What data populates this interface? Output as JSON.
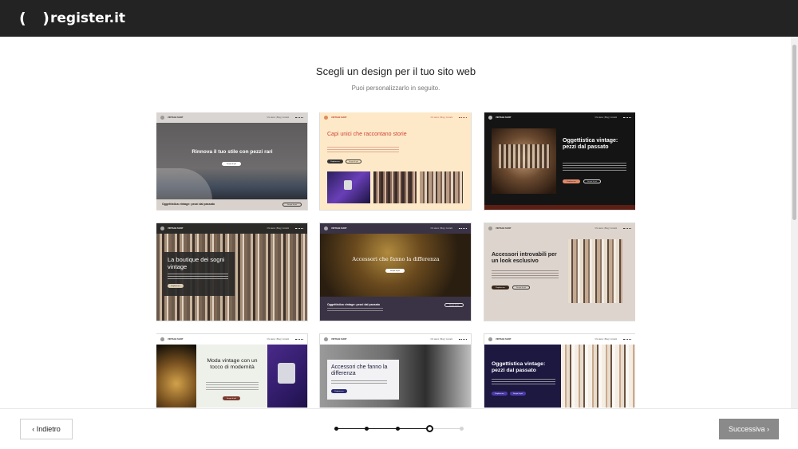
{
  "header": {
    "logo_mark": "( )",
    "logo_text": "register.it"
  },
  "page": {
    "title": "Scegli un design per il tuo sito web",
    "subtitle": "Puoi personalizzarlo in seguito."
  },
  "templates": {
    "t1": {
      "brand": "VINTAGE SHOP",
      "menu": "Chi siamo | Blog | Contatti",
      "headline": "Rinnova il tuo stile con pezzi rari",
      "cta": "Scopri di più",
      "footer_title": "Oggettistica vintage: pezzi dal passato",
      "footer_cta": "Scopri di più"
    },
    "t2": {
      "brand": "VINTAGE SHOP",
      "menu": "Chi siamo | Blog | Contatti",
      "headline": "Capi unici che raccontano storie",
      "cta1": "Esplora ora",
      "cta2": "Scopri di più"
    },
    "t3": {
      "brand": "VINTAGE SHOP",
      "menu": "Chi siamo | Blog | Contatti",
      "headline": "Oggettistica vintage: pezzi dal passato",
      "cta1": "Esplora ora",
      "cta2": "Scopri di più"
    },
    "t4": {
      "brand": "VINTAGE SHOP",
      "menu": "Chi siamo | Blog | Contatti",
      "headline": "La boutique dei sogni vintage",
      "cta": "Esplora ora"
    },
    "t5": {
      "brand": "VINTAGE SHOP",
      "menu": "Chi siamo | Blog | Contatti",
      "headline": "Accessori che fanno la differenza",
      "cta": "Scopri di più",
      "footer_title": "Oggettistica vintage: pezzi dal passato",
      "footer_cta": "Scopri di più"
    },
    "t6": {
      "brand": "VINTAGE SHOP",
      "menu": "Chi siamo | Blog | Contatti",
      "headline": "Accessori introvabili per un look esclusivo",
      "cta1": "Esplora ora",
      "cta2": "Scopri di più"
    },
    "t7": {
      "brand": "VINTAGE SHOP",
      "menu": "Chi siamo | Blog | Contatti",
      "headline": "Moda vintage con un tocco di modernità",
      "cta": "Scopri di più"
    },
    "t8": {
      "brand": "VINTAGE SHOP",
      "menu": "Chi siamo | Blog | Contatti",
      "headline": "Accessori che fanno la differenza",
      "cta": "Esplora ora"
    },
    "t9": {
      "brand": "VINTAGE SHOP",
      "menu": "Chi siamo | Blog | Contatti",
      "headline": "Oggettistica vintage: pezzi dal passato",
      "cta1": "Esplora ora",
      "cta2": "Scopri di più"
    }
  },
  "footer": {
    "back_label": "‹  Indietro",
    "next_label": "Successiva  ›",
    "steps_total": 5,
    "current_step": 4
  },
  "colors": {
    "topbar": "#232323",
    "next_disabled": "#8a8a8a"
  }
}
